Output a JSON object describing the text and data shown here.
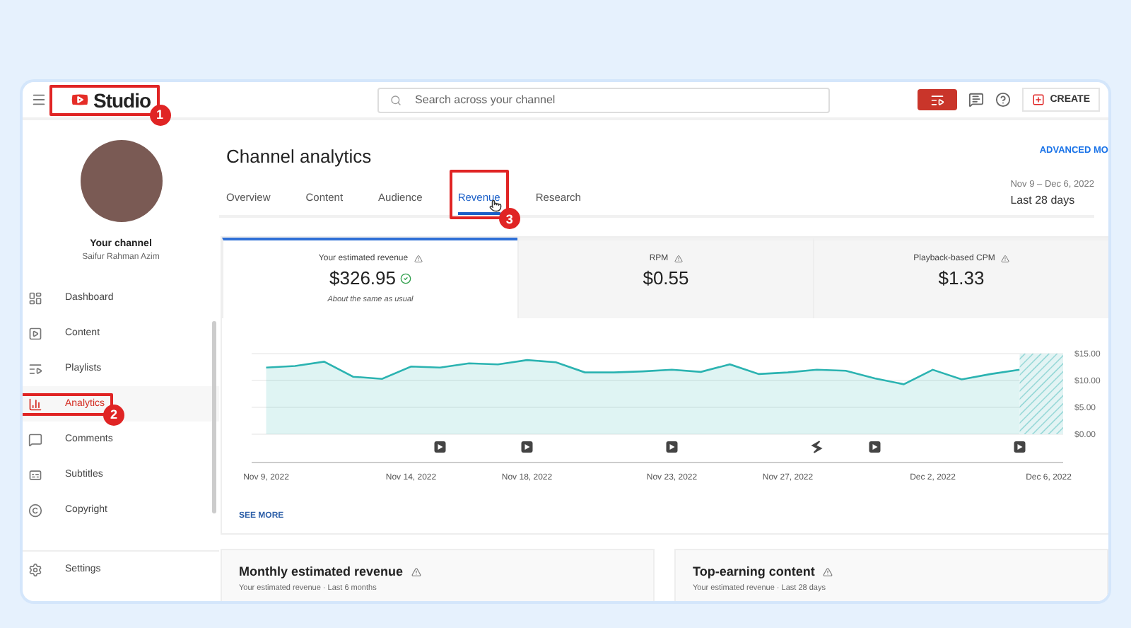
{
  "topbar": {
    "logo": {
      "text": "Studio",
      "callout": "1"
    },
    "search": {
      "placeholder": "Search across your channel"
    },
    "create_button": "CREATE"
  },
  "sidebar": {
    "channel_title": "Your channel",
    "channel_name": "Saifur Rahman Azim",
    "items": [
      {
        "label": "Dashboard",
        "selected": false
      },
      {
        "label": "Content",
        "selected": false
      },
      {
        "label": "Playlists",
        "selected": false
      },
      {
        "label": "Analytics",
        "selected": true,
        "callout": "2"
      },
      {
        "label": "Comments",
        "selected": false
      },
      {
        "label": "Subtitles",
        "selected": false
      },
      {
        "label": "Copyright",
        "selected": false
      }
    ],
    "footer_items": [
      {
        "label": "Settings"
      }
    ]
  },
  "header": {
    "title": "Channel analytics",
    "advanced_link": "ADVANCED MO",
    "date_range": "Nov 9 – Dec 6, 2022",
    "period": "Last 28 days"
  },
  "tabs": [
    {
      "label": "Overview",
      "selected": false
    },
    {
      "label": "Content",
      "selected": false
    },
    {
      "label": "Audience",
      "selected": false
    },
    {
      "label": "Revenue",
      "selected": true,
      "callout": "3"
    },
    {
      "label": "Research",
      "selected": false
    }
  ],
  "metrics": [
    {
      "label": "Your estimated revenue",
      "value": "$326.95",
      "note": "About the same as usual",
      "selected": true
    },
    {
      "label": "RPM",
      "value": "$0.55",
      "selected": false
    },
    {
      "label": "Playback-based CPM",
      "value": "$1.33",
      "selected": false
    }
  ],
  "chart_data": {
    "type": "line",
    "categories": [
      "Nov 9, 2022",
      null,
      null,
      null,
      null,
      "Nov 14, 2022",
      null,
      null,
      null,
      "Nov 18, 2022",
      null,
      null,
      null,
      null,
      "Nov 23, 2022",
      null,
      null,
      null,
      "Nov 27, 2022",
      null,
      null,
      null,
      null,
      "Dec 2, 2022",
      null,
      null,
      null,
      "Dec 6, 2022"
    ],
    "series": [
      {
        "color": "#2bb3b1",
        "values": [
          12.4,
          12.7,
          13.5,
          10.7,
          10.3,
          12.6,
          12.4,
          13.2,
          13.0,
          13.8,
          13.4,
          11.5,
          11.5,
          11.7,
          12.0,
          11.6,
          13.0,
          11.2,
          11.5,
          12.0,
          11.8,
          10.4,
          9.3,
          12.0,
          10.2,
          11.2,
          12.0,
          null
        ]
      }
    ],
    "ylim": [
      0,
      15
    ],
    "yticks": [
      {
        "value": 0,
        "label": "$0.00"
      },
      {
        "value": 5,
        "label": "$5.00"
      },
      {
        "value": 10,
        "label": "$10.00"
      },
      {
        "value": 15,
        "label": "$15.00"
      }
    ]
  },
  "see_more": "SEE MORE",
  "bottom_cards": [
    {
      "title": "Monthly estimated revenue",
      "subtitle": "Your estimated revenue · Last 6 months"
    },
    {
      "title": "Top-earning content",
      "subtitle": "Your estimated revenue · Last 28 days"
    }
  ]
}
